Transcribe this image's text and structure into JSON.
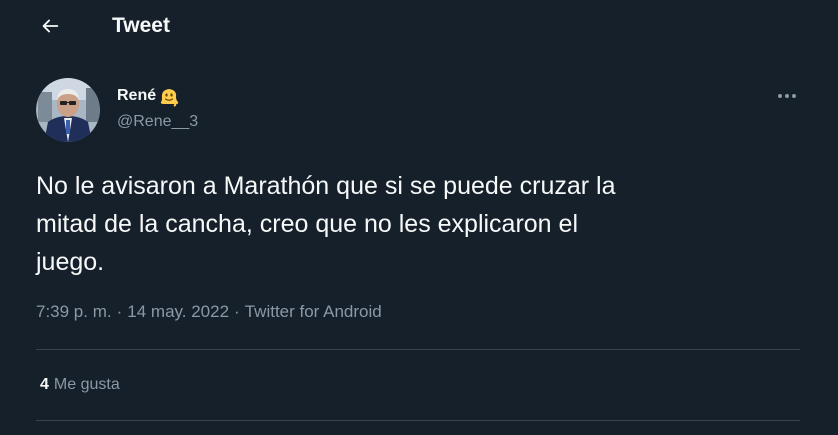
{
  "header": {
    "title": "Tweet",
    "back_icon": "arrow-left-icon"
  },
  "tweet": {
    "author": {
      "name": "René",
      "emoji": "melting-face-emoji",
      "handle": "@Rene__3"
    },
    "text": "No le avisaron a Marathón que si se puede cruzar la\nmitad de la cancha, creo que no les explicaron el\njuego.",
    "time": "7:39 p. m.",
    "date": "14 may. 2022",
    "source": "Twitter for Android",
    "separator": "·",
    "likes": {
      "count": "4",
      "label": "Me gusta"
    }
  },
  "colors": {
    "background": "#15202b",
    "text": "#f7f9f9",
    "secondary": "#8b98a5",
    "divider": "#38444d"
  }
}
